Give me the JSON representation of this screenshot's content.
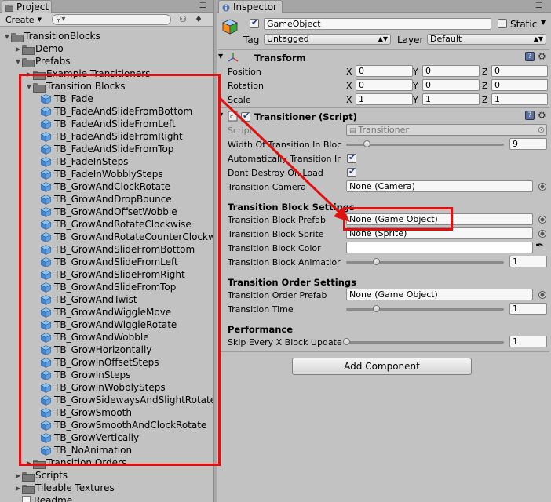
{
  "project": {
    "tab_label": "Project",
    "create_label": "Create",
    "search_placeholder": "",
    "tree": [
      {
        "label": "TransitionBlocks",
        "indent": 0,
        "kind": "folder",
        "arrow": "open"
      },
      {
        "label": "Demo",
        "indent": 1,
        "kind": "folder",
        "arrow": "closed"
      },
      {
        "label": "Prefabs",
        "indent": 1,
        "kind": "folder",
        "arrow": "open"
      },
      {
        "label": "Example Transitioners",
        "indent": 2,
        "kind": "folder",
        "arrow": "closed"
      },
      {
        "label": "Transition Blocks",
        "indent": 2,
        "kind": "folder",
        "arrow": "open"
      },
      {
        "label": "TB_Fade",
        "indent": 3,
        "kind": "prefab"
      },
      {
        "label": "TB_FadeAndSlideFromBottom",
        "indent": 3,
        "kind": "prefab"
      },
      {
        "label": "TB_FadeAndSlideFromLeft",
        "indent": 3,
        "kind": "prefab"
      },
      {
        "label": "TB_FadeAndSlideFromRight",
        "indent": 3,
        "kind": "prefab"
      },
      {
        "label": "TB_FadeAndSlideFromTop",
        "indent": 3,
        "kind": "prefab"
      },
      {
        "label": "TB_FadeInSteps",
        "indent": 3,
        "kind": "prefab"
      },
      {
        "label": "TB_FadeInWobblySteps",
        "indent": 3,
        "kind": "prefab"
      },
      {
        "label": "TB_GrowAndClockRotate",
        "indent": 3,
        "kind": "prefab"
      },
      {
        "label": "TB_GrowAndDropBounce",
        "indent": 3,
        "kind": "prefab"
      },
      {
        "label": "TB_GrowAndOffsetWobble",
        "indent": 3,
        "kind": "prefab"
      },
      {
        "label": "TB_GrowAndRotateClockwise",
        "indent": 3,
        "kind": "prefab"
      },
      {
        "label": "TB_GrowAndRotateCounterClockw",
        "indent": 3,
        "kind": "prefab"
      },
      {
        "label": "TB_GrowAndSlideFromBottom",
        "indent": 3,
        "kind": "prefab"
      },
      {
        "label": "TB_GrowAndSlideFromLeft",
        "indent": 3,
        "kind": "prefab"
      },
      {
        "label": "TB_GrowAndSlideFromRight",
        "indent": 3,
        "kind": "prefab"
      },
      {
        "label": "TB_GrowAndSlideFromTop",
        "indent": 3,
        "kind": "prefab"
      },
      {
        "label": "TB_GrowAndTwist",
        "indent": 3,
        "kind": "prefab"
      },
      {
        "label": "TB_GrowAndWiggleMove",
        "indent": 3,
        "kind": "prefab"
      },
      {
        "label": "TB_GrowAndWiggleRotate",
        "indent": 3,
        "kind": "prefab"
      },
      {
        "label": "TB_GrowAndWobble",
        "indent": 3,
        "kind": "prefab"
      },
      {
        "label": "TB_GrowHorizontally",
        "indent": 3,
        "kind": "prefab"
      },
      {
        "label": "TB_GrowInOffsetSteps",
        "indent": 3,
        "kind": "prefab"
      },
      {
        "label": "TB_GrowInSteps",
        "indent": 3,
        "kind": "prefab"
      },
      {
        "label": "TB_GrowInWobblySteps",
        "indent": 3,
        "kind": "prefab"
      },
      {
        "label": "TB_GrowSidewaysAndSlightRotate",
        "indent": 3,
        "kind": "prefab"
      },
      {
        "label": "TB_GrowSmooth",
        "indent": 3,
        "kind": "prefab"
      },
      {
        "label": "TB_GrowSmoothAndClockRotate",
        "indent": 3,
        "kind": "prefab"
      },
      {
        "label": "TB_GrowVertically",
        "indent": 3,
        "kind": "prefab"
      },
      {
        "label": "TB_NoAnimation",
        "indent": 3,
        "kind": "prefab"
      },
      {
        "label": "Transition Orders",
        "indent": 2,
        "kind": "folder",
        "arrow": "closed"
      },
      {
        "label": "Scripts",
        "indent": 1,
        "kind": "folder",
        "arrow": "closed"
      },
      {
        "label": "Tileable Textures",
        "indent": 1,
        "kind": "folder",
        "arrow": "closed"
      },
      {
        "label": "Readme",
        "indent": 1,
        "kind": "file"
      }
    ]
  },
  "inspector": {
    "tab_label": "Inspector",
    "object_name": "GameObject",
    "static_label": "Static",
    "tag_label": "Tag",
    "tag_value": "Untagged",
    "layer_label": "Layer",
    "layer_value": "Default",
    "transform": {
      "title": "Transform",
      "rows": [
        {
          "label": "Position",
          "x": "0",
          "y": "0",
          "z": "0"
        },
        {
          "label": "Rotation",
          "x": "0",
          "y": "0",
          "z": "0"
        },
        {
          "label": "Scale",
          "x": "1",
          "y": "1",
          "z": "1"
        }
      ],
      "axis_x": "X",
      "axis_y": "Y",
      "axis_z": "Z"
    },
    "transitioner": {
      "title": "Transitioner (Script)",
      "script_label": "Script",
      "script_value": "Transitioner",
      "width_label": "Width Of Transition In Bloc",
      "width_value": "9",
      "width_fraction": 0.13,
      "auto_label": "Automatically Transition Ir",
      "dont_destroy_label": "Dont Destroy On Load",
      "camera_label": "Transition Camera",
      "camera_value": "None (Camera)",
      "block_settings_title": "Transition Block Settings",
      "block_prefab_label": "Transition Block Prefab",
      "block_prefab_value": "None (Game Object)",
      "block_sprite_label": "Transition Block Sprite",
      "block_sprite_value": "None (Sprite)",
      "block_color_label": "Transition Block Color",
      "block_anim_label": "Transition Block Animatior",
      "block_anim_value": "1",
      "block_anim_fraction": 0.19,
      "order_settings_title": "Transition Order Settings",
      "order_prefab_label": "Transition Order Prefab",
      "order_prefab_value": "None (Game Object)",
      "time_label": "Transition Time",
      "time_value": "1",
      "time_fraction": 0.19,
      "perf_title": "Performance",
      "skip_label": "Skip Every X Block Update",
      "skip_value": "1",
      "skip_fraction": 0.0
    },
    "add_component_label": "Add Component"
  },
  "colors": {
    "annotation_red": "#e01010",
    "panel_bg": "#c2c2c2",
    "prefab_blue": "#4a90d9"
  }
}
